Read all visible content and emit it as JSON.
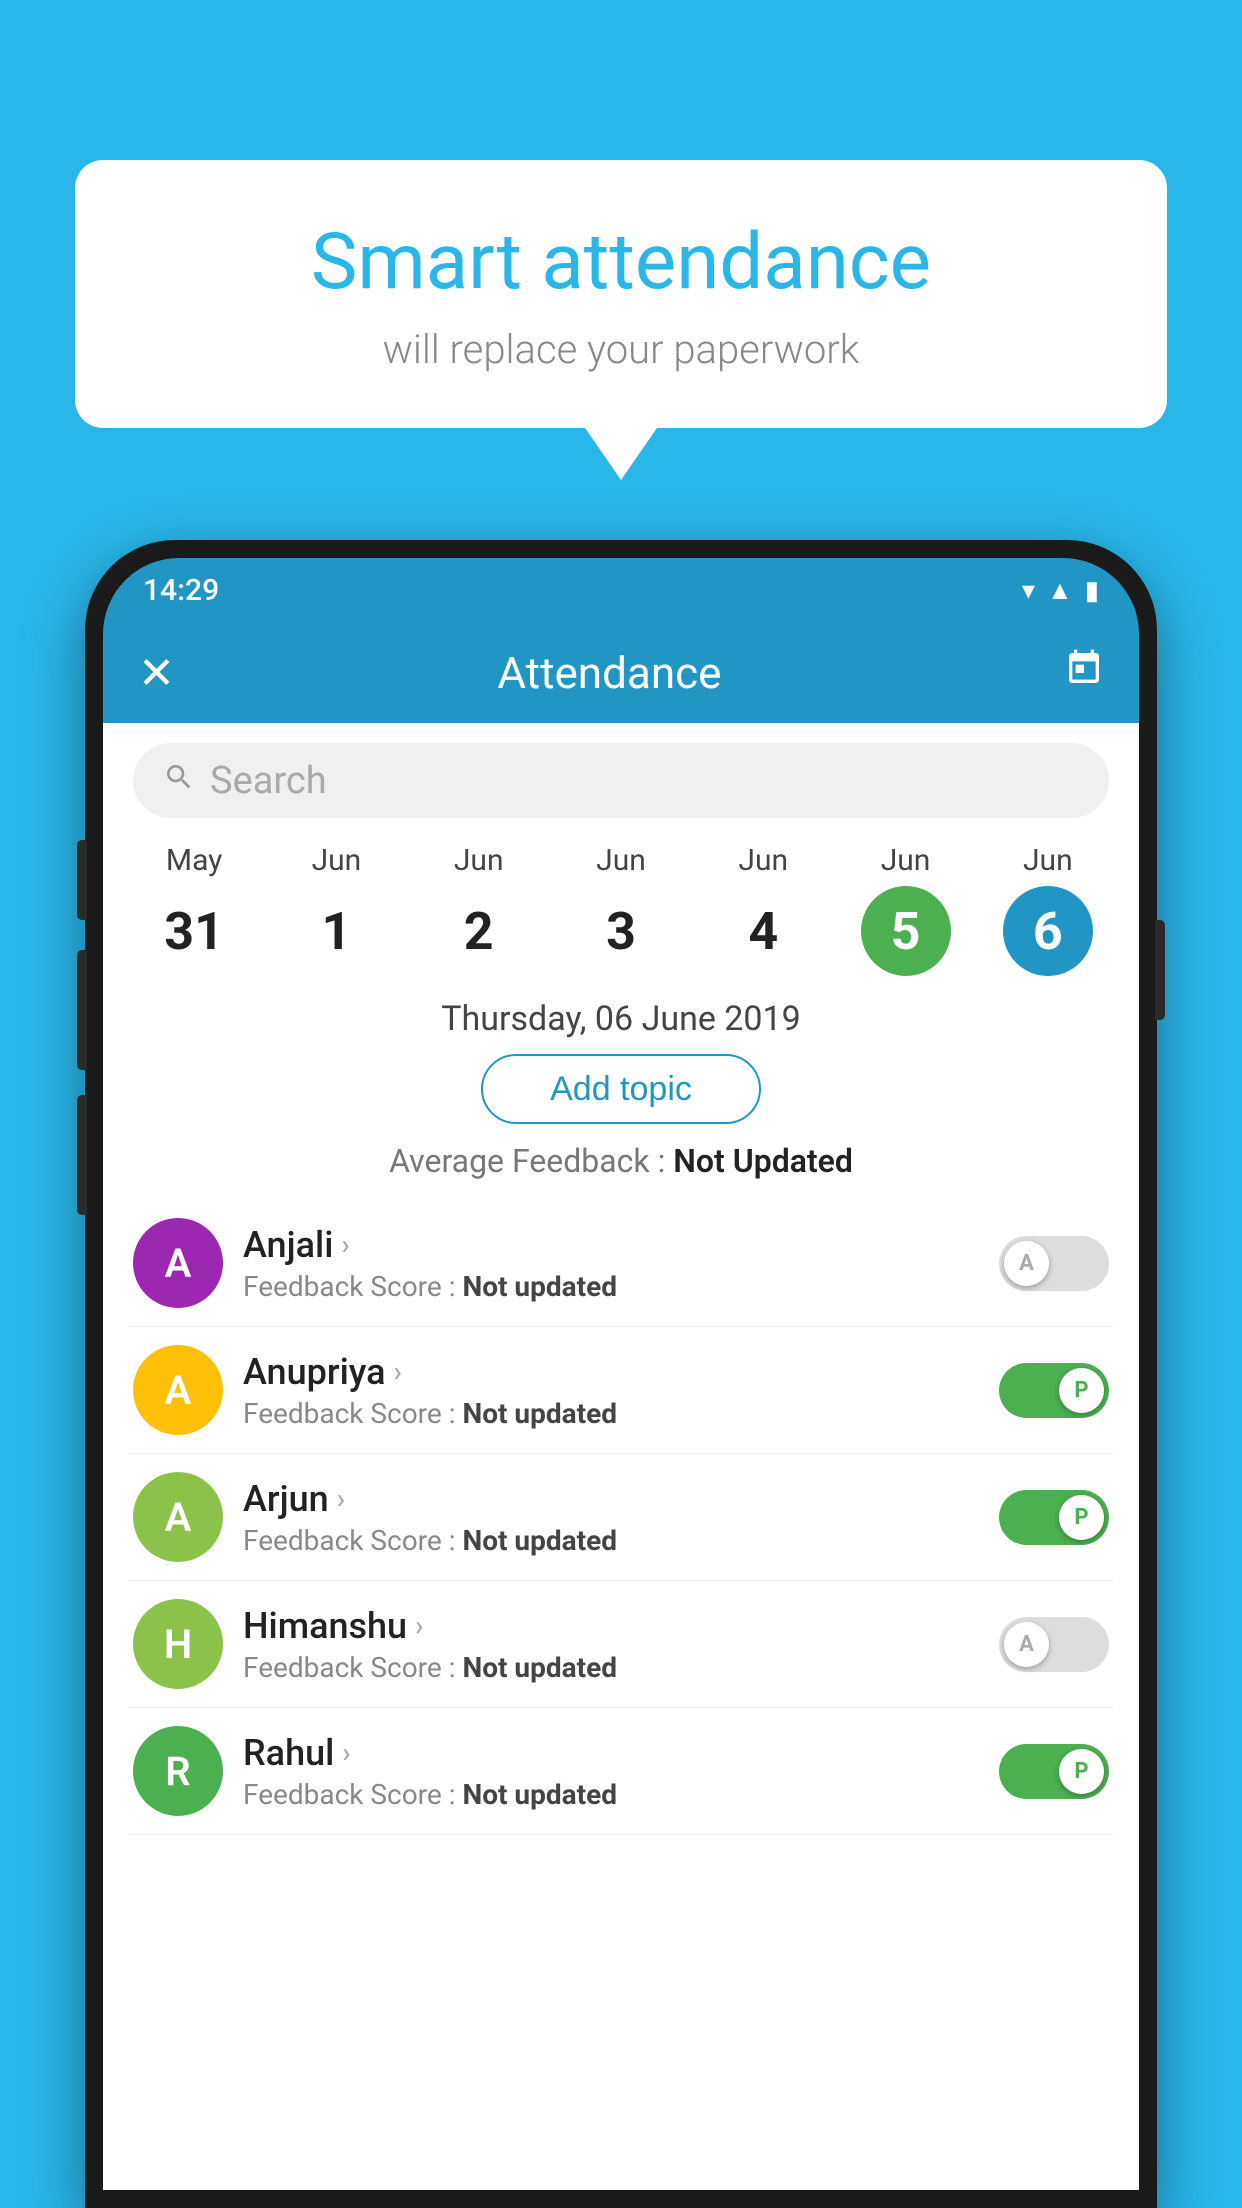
{
  "background_color": "#29B6E8",
  "speech_bubble": {
    "title": "Smart attendance",
    "subtitle": "will replace your paperwork"
  },
  "status_bar": {
    "time": "14:29",
    "icons": [
      "wifi",
      "signal",
      "battery"
    ]
  },
  "app_bar": {
    "close_label": "✕",
    "title": "Attendance",
    "calendar_icon": "📅"
  },
  "search": {
    "placeholder": "Search"
  },
  "calendar": {
    "days": [
      {
        "month": "May",
        "date": "31",
        "state": "normal"
      },
      {
        "month": "Jun",
        "date": "1",
        "state": "normal"
      },
      {
        "month": "Jun",
        "date": "2",
        "state": "normal"
      },
      {
        "month": "Jun",
        "date": "3",
        "state": "normal"
      },
      {
        "month": "Jun",
        "date": "4",
        "state": "normal"
      },
      {
        "month": "Jun",
        "date": "5",
        "state": "today"
      },
      {
        "month": "Jun",
        "date": "6",
        "state": "selected"
      }
    ]
  },
  "selected_date": "Thursday, 06 June 2019",
  "add_topic_label": "Add topic",
  "avg_feedback_label": "Average Feedback :",
  "avg_feedback_value": "Not Updated",
  "students": [
    {
      "name": "Anjali",
      "initial": "A",
      "avatar_color": "#9C27B0",
      "feedback_label": "Feedback Score :",
      "feedback_value": "Not updated",
      "toggle_state": "off",
      "toggle_label": "A"
    },
    {
      "name": "Anupriya",
      "initial": "A",
      "avatar_color": "#FFC107",
      "feedback_label": "Feedback Score :",
      "feedback_value": "Not updated",
      "toggle_state": "on",
      "toggle_label": "P"
    },
    {
      "name": "Arjun",
      "initial": "A",
      "avatar_color": "#8BC34A",
      "feedback_label": "Feedback Score :",
      "feedback_value": "Not updated",
      "toggle_state": "on",
      "toggle_label": "P"
    },
    {
      "name": "Himanshu",
      "initial": "H",
      "avatar_color": "#8BC34A",
      "feedback_label": "Feedback Score :",
      "feedback_value": "Not updated",
      "toggle_state": "off",
      "toggle_label": "A"
    },
    {
      "name": "Rahul",
      "initial": "R",
      "avatar_color": "#4CAF50",
      "feedback_label": "Feedback Score :",
      "feedback_value": "Not updated",
      "toggle_state": "on",
      "toggle_label": "P"
    }
  ]
}
